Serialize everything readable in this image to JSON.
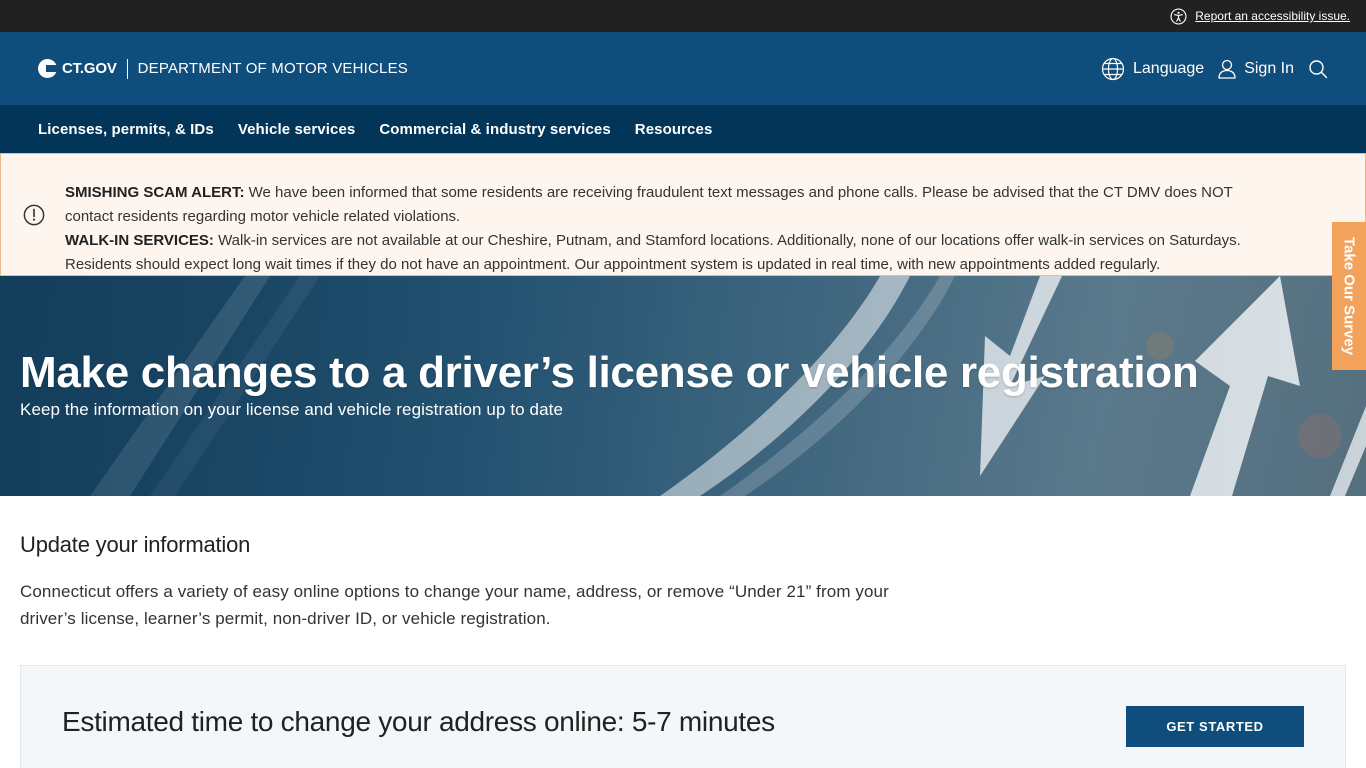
{
  "utility_bar": {
    "accessibility_label": "Report an accessibility issue."
  },
  "header": {
    "brand_logo_text": "CT.GOV",
    "department": "DEPARTMENT OF MOTOR VEHICLES",
    "language_label": "Language",
    "sign_in_label": "Sign In"
  },
  "nav": {
    "items": [
      {
        "label": "Licenses, permits, & IDs"
      },
      {
        "label": "Vehicle services"
      },
      {
        "label": "Commercial & industry services"
      },
      {
        "label": "Resources"
      }
    ]
  },
  "alert": {
    "smishing_title": "SMISHING SCAM ALERT:",
    "smishing_text_1": " We have been informed that some residents are receiving fraudulent text messages and phone calls. Please be advised that the CT DMV does NOT",
    "smishing_text_2": "contact residents regarding motor vehicle related violations.",
    "walkin_title": "WALK-IN SERVICES:",
    "walkin_text_1": " Walk-in services are not available at our Cheshire, Putnam, and Stamford locations. Additionally, none of our locations offer walk-in services on Saturdays.",
    "walkin_text_2": "Residents should expect long wait times if they do not have an appointment. Our appointment system is updated in real time, with new appointments added regularly."
  },
  "survey_tab": {
    "label": "Take Our Survey"
  },
  "hero": {
    "title": "Make changes to a driver’s license or vehicle registration",
    "subtitle": "Keep the information on your license and vehicle registration up to date"
  },
  "content": {
    "section_title": "Update your information",
    "description": "Connecticut offers a variety of easy online options to change your name, address, or remove “Under 21” from your driver’s license, learner’s permit, non-driver ID, or vehicle registration.",
    "time_card_text": "Estimated time to change your address online: 5-7 minutes",
    "get_started_label": "GET STARTED"
  },
  "colors": {
    "header_blue": "#0f4d7c",
    "nav_dark_blue": "#023558",
    "alert_bg": "#fdf5ee",
    "survey_orange": "#f2a25a"
  }
}
